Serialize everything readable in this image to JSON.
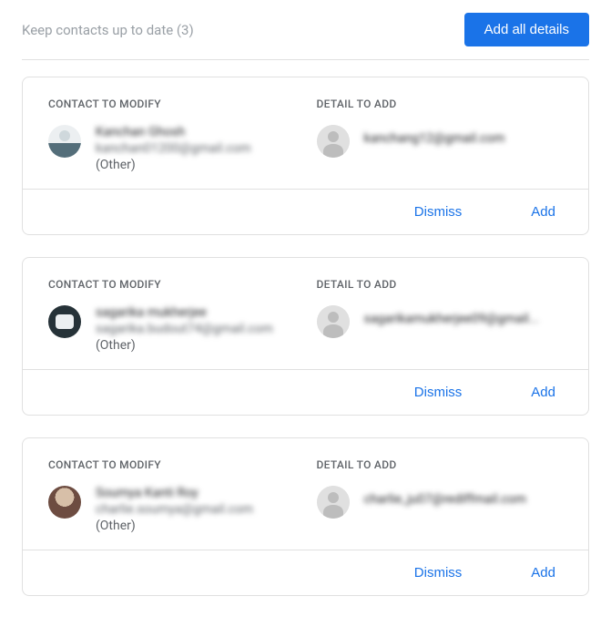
{
  "header": {
    "title": "Keep contacts up to date (3)",
    "add_all_label": "Add all details"
  },
  "labels": {
    "contact_header": "CONTACT TO MODIFY",
    "detail_header": "DETAIL TO ADD",
    "dismiss": "Dismiss",
    "add": "Add"
  },
  "cards": [
    {
      "name": "Kanchan Ghosh",
      "email": "kanchan01200@gmail.com",
      "type": "(Other)",
      "detail_email": "kanchang12@gmail.com"
    },
    {
      "name": "sagarika mukherjee",
      "email": "sagarika.budout74@gmail.com",
      "type": "(Other)",
      "detail_email": "sagarikamukherjee09@gmail..."
    },
    {
      "name": "Soumya Kanti Roy",
      "email": "charlie.soumya@gmail.com",
      "type": "(Other)",
      "detail_email": "charlie_ju07@rediffmail.com"
    }
  ]
}
